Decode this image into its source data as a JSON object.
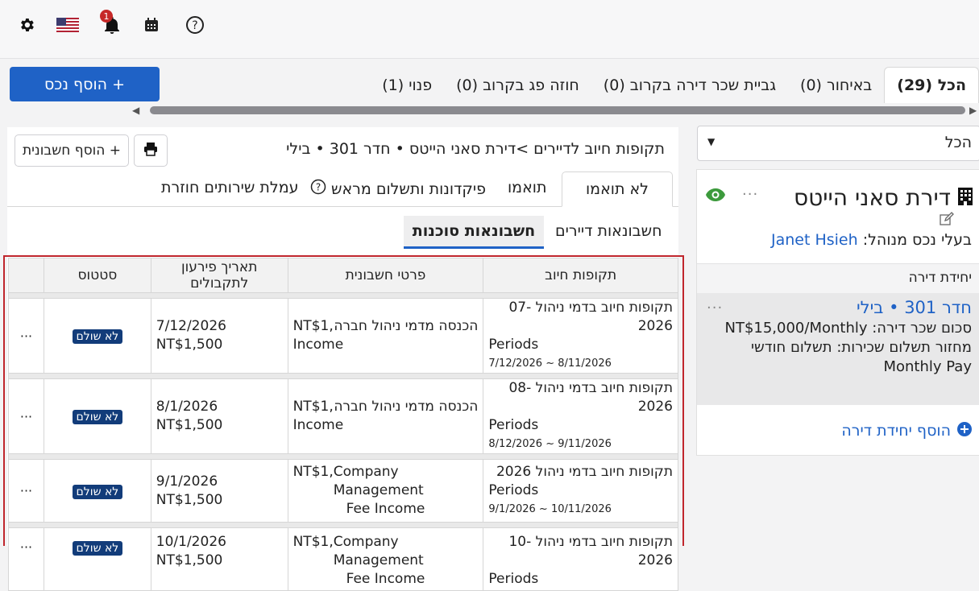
{
  "topbar": {
    "icons": [
      "gear-icon",
      "us-flag-icon",
      "bell-icon",
      "calendar-icon",
      "help-icon"
    ],
    "notification_count": "1"
  },
  "actions": {
    "add_property": "+ הוסף נכס"
  },
  "tabs": [
    {
      "label": "הכל (29)",
      "active": true
    },
    {
      "label": "באיחור (0)"
    },
    {
      "label": "גביית שכר דירה בקרוב (0)"
    },
    {
      "label": "חוזה פג בקרוב (0)"
    },
    {
      "label": "פנוי (1)"
    }
  ],
  "filter": {
    "selected": "הכל"
  },
  "property": {
    "name": "דירת סאני הייטס",
    "owner_label": "בעלי נכס מנוהל:",
    "owner_name": "Janet Hsieh",
    "units_header": "יחידת דירה",
    "unit": {
      "title": "חדר 301 • בילי",
      "rent": "סכום שכר דירה: NT$15,000/Monthly",
      "cycle": "מחזור תשלום שכירות: תשלום חודשי",
      "cycle_en": "Monthly Pay"
    },
    "add_unit": "הוסף יחידת דירה"
  },
  "main": {
    "breadcrumb": "תקופות חיוב לדיירים >דירת סאני הייטס • חדר 301 • בילי",
    "add_invoice": "+ הוסף חשבונית",
    "subtabs": [
      {
        "label": "לא תואמו",
        "active": true
      },
      {
        "label": "תואמו"
      },
      {
        "label": "פיקדונות ותשלום מראש"
      },
      {
        "label": "עמלת שירותים חוזרת"
      }
    ],
    "invoice_tabs": [
      {
        "label": "חשבונאות דיירים"
      },
      {
        "label": "חשבונאות סוכנות",
        "active": true
      }
    ]
  },
  "table": {
    "headers": [
      "תקופות חיוב",
      "פרטי חשבונית",
      "תאריך פירעון לתקבולים",
      "סטטוס"
    ],
    "rows": [
      {
        "period_title": "תקופות חיוב בדמי ניהול 07-2026",
        "period_en": "Periods",
        "period_range": "7/12/2026 ~ 8/11/2026",
        "detail_amount": "NT$1,",
        "detail_text": "הכנסה מדמי ניהול חברה",
        "detail_text2": "Income",
        "due_date": "7/12/2026",
        "due_amount": "NT$1,500",
        "status": "לא שולם"
      },
      {
        "period_title": "תקופות חיוב בדמי ניהול 08-2026",
        "period_en": "Periods",
        "period_range": "8/12/2026 ~ 9/11/2026",
        "detail_amount": "NT$1,",
        "detail_text": "הכנסה מדמי ניהול חברה",
        "detail_text2": "Income",
        "due_date": "8/1/2026",
        "due_amount": "NT$1,500",
        "status": "לא שולם"
      },
      {
        "period_title": "תקופות חיוב בדמי ניהול 2026",
        "period_en": "Periods",
        "period_range": "9/1/2026 ~ 10/11/2026",
        "detail_amount": "NT$1,",
        "detail_text": "Company Management",
        "detail_text2": "Fee Income",
        "due_date": "9/1/2026",
        "due_amount": "NT$1,500",
        "status": "לא שולם"
      },
      {
        "period_title": "תקופות חיוב בדמי ניהול 10-2026",
        "period_en": "Periods",
        "period_range": "",
        "detail_amount": "NT$1,",
        "detail_text": "Company Management",
        "detail_text2": "Fee Income",
        "due_date": "10/1/2026",
        "due_amount": "NT$1,500",
        "status": "לא שולם"
      }
    ],
    "more_label": "···"
  },
  "colors": {
    "primary": "#1f62c6",
    "status_badge": "#123c7a",
    "highlight_frame": "#c0262d",
    "eye": "#3c9a3c"
  }
}
